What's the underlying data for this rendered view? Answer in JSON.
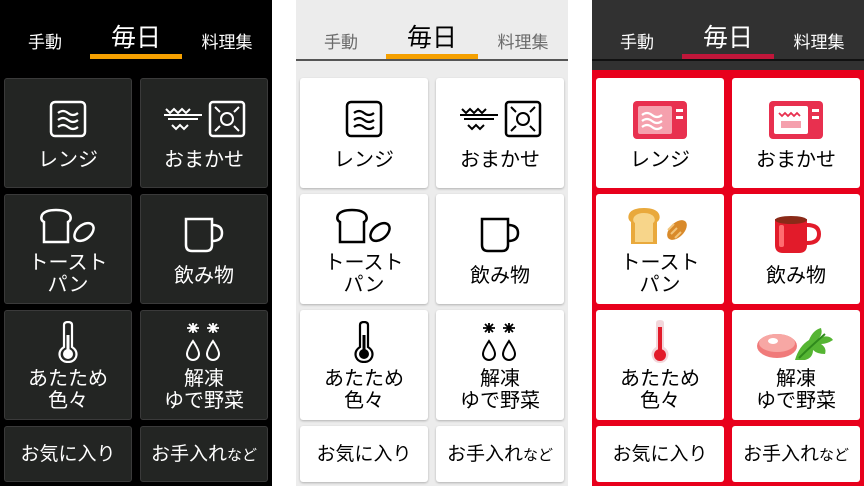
{
  "tabs": {
    "left": "手動",
    "center": "毎日",
    "right": "料理集"
  },
  "buttons": {
    "range": "レンジ",
    "omakase": "おまかせ",
    "toast_l1": "トースト",
    "toast_l2": "パン",
    "drinks": "飲み物",
    "warm_l1": "あたため",
    "warm_l2": "色々",
    "thaw_l1": "解凍",
    "thaw_l2": "ゆで野菜",
    "favorites": "お気に入り",
    "care_main": "お手入れ",
    "care_suffix": "など"
  },
  "themes": {
    "dark": {
      "background": "#000000",
      "button": "#232523",
      "accent": "#f5a000"
    },
    "light": {
      "background": "#ececec",
      "button": "#ffffff",
      "accent": "#f5a000"
    },
    "red": {
      "background": "#313131",
      "button": "#ffffff",
      "accent": "#c0163a",
      "grid": "#e8001c"
    }
  },
  "icons": [
    "microwave-icon",
    "auto-cook-icon",
    "toast-bread-icon",
    "mug-icon",
    "thermometer-icon",
    "thaw-drops-icon"
  ]
}
